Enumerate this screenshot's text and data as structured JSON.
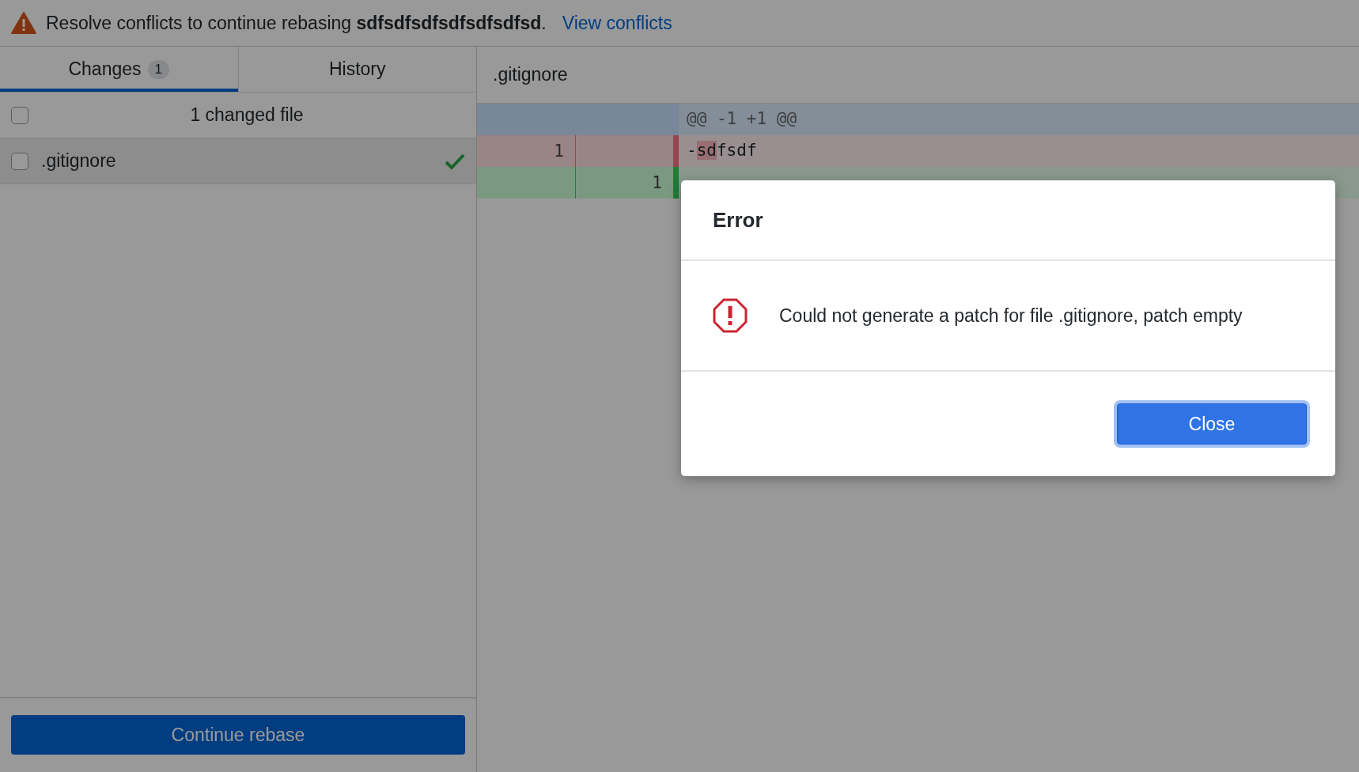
{
  "banner": {
    "message": "Resolve conflicts to continue rebasing **sdfsdfsdfsdfsdfsdfsd**.",
    "link": "View conflicts"
  },
  "tabs": [
    {
      "label": "Changes",
      "badge": "1",
      "selected": true
    },
    {
      "label": "History",
      "selected": false
    }
  ],
  "changes": {
    "header": "1 changed file",
    "checked": false,
    "files": [
      {
        "name": ".gitignore",
        "checked": false,
        "selected": true,
        "resolved": true
      }
    ]
  },
  "continue_button": {
    "label": "Continue rebase"
  },
  "diff": {
    "file": ".gitignore",
    "lines": [
      {
        "kind": "hunk",
        "rest": "@@ -1 +1 @@"
      },
      {
        "kind": "del",
        "old": "1",
        "prefix": "-",
        "changed": "sd",
        "rest": "fsdf"
      },
      {
        "kind": "add",
        "new": "1"
      }
    ]
  },
  "dialog": {
    "title": "Error",
    "message": "Could not generate a patch for file .gitignore, patch empty",
    "button": "Close"
  }
}
